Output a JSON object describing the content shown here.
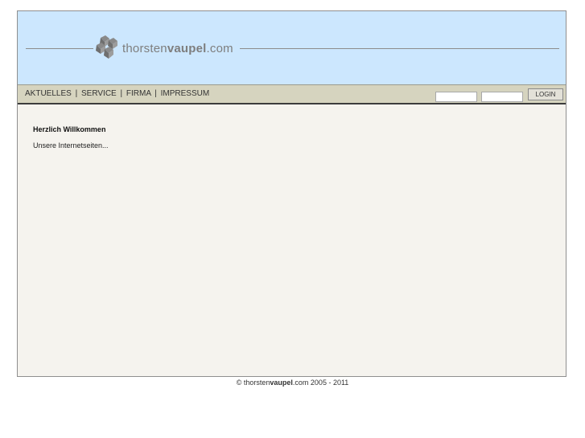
{
  "logo": {
    "brand_light": "thorsten",
    "brand_bold": "vaupel",
    "brand_suffix": ".com",
    "icon": "cubes-icon"
  },
  "nav": {
    "items": [
      "AKTUELLES",
      "SERVICE",
      "FIRMA",
      "IMPRESSUM"
    ],
    "separator": "|"
  },
  "login": {
    "username_value": "",
    "password_value": "",
    "button_label": "LOGIN"
  },
  "content": {
    "heading": "Herzlich Willkommen",
    "text": "Unsere Internetseiten..."
  },
  "footer": {
    "copyright": "©",
    "brand_light": "thorsten",
    "brand_bold": "vaupel",
    "brand_suffix": ".com",
    "years": "2005 - 2011"
  },
  "colors": {
    "header_bg": "#cce7fe",
    "navbar_bg": "#d6d4bf",
    "content_bg": "#f5f3ee",
    "logo_gray": "#7e7e7e"
  }
}
